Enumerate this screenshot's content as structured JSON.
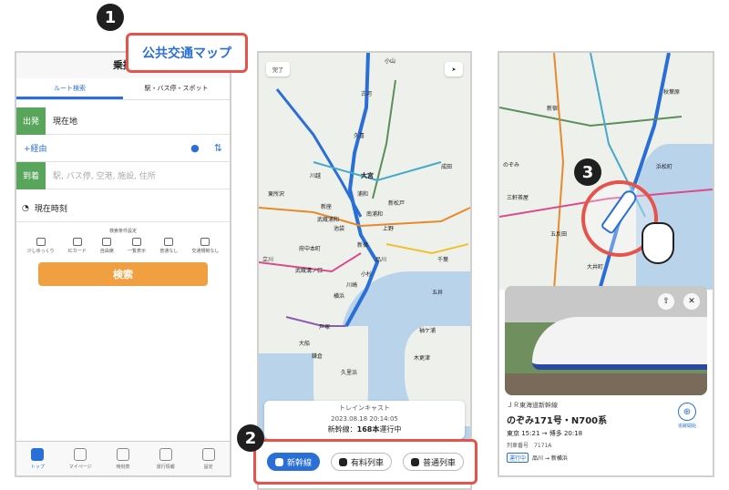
{
  "steps": [
    "1",
    "2",
    "3"
  ],
  "callout": "公共交通マップ",
  "screen1": {
    "title": "乗換",
    "tabs": [
      "ルート検索",
      "駅・バス停・スポット"
    ],
    "from_label": "出発",
    "from_value": "現在地",
    "via_label": "+経由",
    "to_label": "到着",
    "to_placeholder": "駅, バス停, 空港, 施設, 住所",
    "time_label": "現在時刻",
    "options_title": "検索条件設定",
    "options": [
      "少しゆっくり",
      "ICカード",
      "自由席",
      "一覧表示",
      "普通なし",
      "交通規制なし"
    ],
    "search_button": "検索",
    "bottom_nav": [
      "トップ",
      "マイページ",
      "時刻表",
      "運行情報",
      "設定"
    ]
  },
  "screen2": {
    "done_button": "完了",
    "stations": [
      "小山",
      "古河",
      "久喜",
      "大宮",
      "浦和",
      "川越",
      "新座",
      "武蔵浦和",
      "南浦和",
      "東所沢",
      "新松戸",
      "池袋",
      "上野",
      "立川",
      "府中本町",
      "新宿",
      "品川",
      "武蔵溝ノ口",
      "小杉",
      "川崎",
      "横浜",
      "戸塚",
      "大船",
      "鎌倉",
      "久里浜",
      "五井",
      "千葉",
      "袖ケ浦",
      "木更津",
      "成田"
    ],
    "card_title": "トレインキャスト",
    "timestamp": "2023.08.18 20:14:05",
    "status_prefix": "新幹線：",
    "status_count": "168本",
    "status_suffix": "運行中",
    "filters": [
      "新幹線",
      "有料列車",
      "普通列車"
    ]
  },
  "screen3": {
    "stations": [
      "新宿",
      "浜松町",
      "のぞみ",
      "三軒茶屋",
      "五反田",
      "秋葉原",
      "大井町"
    ],
    "line_name": "ＪＲ東海道新幹線",
    "train_name": "のぞみ171号・N700系",
    "schedule": "東京 15:21 → 博多 20:18",
    "train_no": "列車番号　7171A",
    "status_badge": "運行中",
    "segment": "品川 → 新横浜",
    "follow_label": "追跡開始"
  }
}
